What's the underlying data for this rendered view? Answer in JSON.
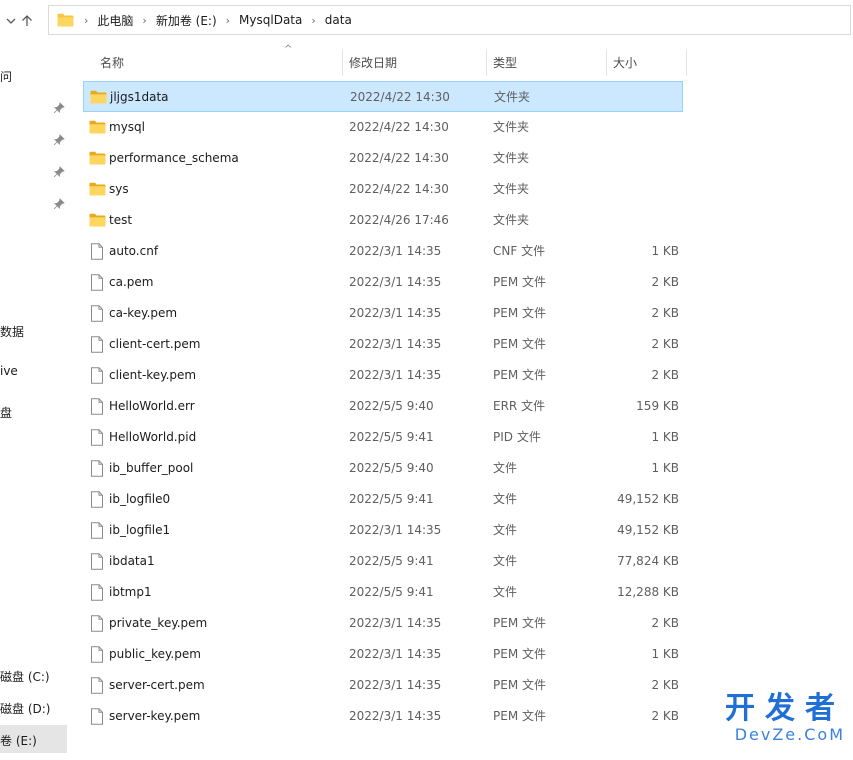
{
  "address": {
    "segments": [
      "此电脑",
      "新加卷 (E:)",
      "MysqlData",
      "data"
    ]
  },
  "left_pane": {
    "items": [
      "问",
      "数据",
      "ive",
      "盘",
      "磁盘 (C:)",
      "磁盘 (D:)",
      "卷 (E:)"
    ]
  },
  "columns": {
    "name": "名称",
    "date": "修改日期",
    "type": "类型",
    "size": "大小"
  },
  "files": [
    {
      "name": "jljgs1data",
      "date": "2022/4/22 14:30",
      "type": "文件夹",
      "size": "",
      "kind": "folder-icon",
      "selected": true
    },
    {
      "name": "mysql",
      "date": "2022/4/22 14:30",
      "type": "文件夹",
      "size": "",
      "kind": "folder-icon"
    },
    {
      "name": "performance_schema",
      "date": "2022/4/22 14:30",
      "type": "文件夹",
      "size": "",
      "kind": "folder-icon"
    },
    {
      "name": "sys",
      "date": "2022/4/22 14:30",
      "type": "文件夹",
      "size": "",
      "kind": "folder-icon"
    },
    {
      "name": "test",
      "date": "2022/4/26 17:46",
      "type": "文件夹",
      "size": "",
      "kind": "folder-icon"
    },
    {
      "name": "auto.cnf",
      "date": "2022/3/1 14:35",
      "type": "CNF 文件",
      "size": "1 KB",
      "kind": "file-icon"
    },
    {
      "name": "ca.pem",
      "date": "2022/3/1 14:35",
      "type": "PEM 文件",
      "size": "2 KB",
      "kind": "file-icon"
    },
    {
      "name": "ca-key.pem",
      "date": "2022/3/1 14:35",
      "type": "PEM 文件",
      "size": "2 KB",
      "kind": "file-icon"
    },
    {
      "name": "client-cert.pem",
      "date": "2022/3/1 14:35",
      "type": "PEM 文件",
      "size": "2 KB",
      "kind": "file-icon"
    },
    {
      "name": "client-key.pem",
      "date": "2022/3/1 14:35",
      "type": "PEM 文件",
      "size": "2 KB",
      "kind": "file-icon"
    },
    {
      "name": "HelloWorld.err",
      "date": "2022/5/5 9:40",
      "type": "ERR 文件",
      "size": "159 KB",
      "kind": "file-icon"
    },
    {
      "name": "HelloWorld.pid",
      "date": "2022/5/5 9:41",
      "type": "PID 文件",
      "size": "1 KB",
      "kind": "file-icon"
    },
    {
      "name": "ib_buffer_pool",
      "date": "2022/5/5 9:40",
      "type": "文件",
      "size": "1 KB",
      "kind": "file-icon"
    },
    {
      "name": "ib_logfile0",
      "date": "2022/5/5 9:41",
      "type": "文件",
      "size": "49,152 KB",
      "kind": "file-icon"
    },
    {
      "name": "ib_logfile1",
      "date": "2022/3/1 14:35",
      "type": "文件",
      "size": "49,152 KB",
      "kind": "file-icon"
    },
    {
      "name": "ibdata1",
      "date": "2022/5/5 9:41",
      "type": "文件",
      "size": "77,824 KB",
      "kind": "file-icon"
    },
    {
      "name": "ibtmp1",
      "date": "2022/5/5 9:41",
      "type": "文件",
      "size": "12,288 KB",
      "kind": "file-icon"
    },
    {
      "name": "private_key.pem",
      "date": "2022/3/1 14:35",
      "type": "PEM 文件",
      "size": "2 KB",
      "kind": "file-icon"
    },
    {
      "name": "public_key.pem",
      "date": "2022/3/1 14:35",
      "type": "PEM 文件",
      "size": "1 KB",
      "kind": "file-icon"
    },
    {
      "name": "server-cert.pem",
      "date": "2022/3/1 14:35",
      "type": "PEM 文件",
      "size": "2 KB",
      "kind": "file-icon"
    },
    {
      "name": "server-key.pem",
      "date": "2022/3/1 14:35",
      "type": "PEM 文件",
      "size": "2 KB",
      "kind": "file-icon"
    }
  ],
  "watermark": {
    "big": "开发者",
    "small": "DevZe.CoM"
  },
  "colors": {
    "selection_bg": "#cce8ff",
    "selection_border": "#99d1ff",
    "folder": "#f8c542",
    "watermark": "#1f6fd6"
  }
}
